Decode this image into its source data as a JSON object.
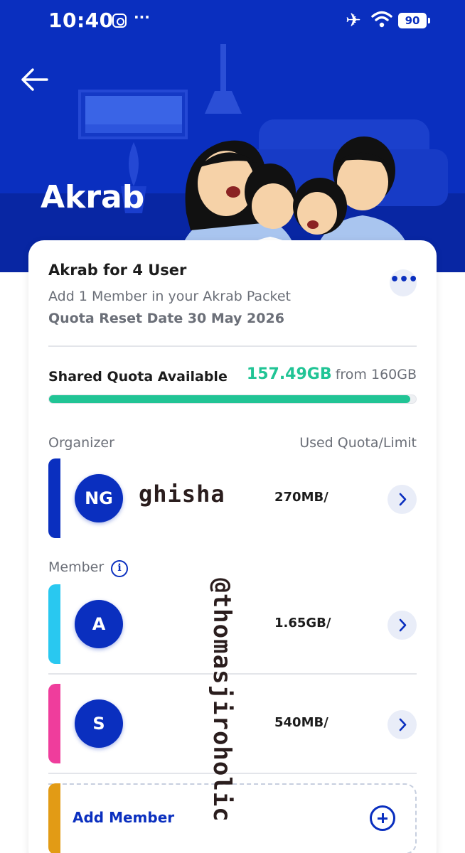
{
  "status_bar": {
    "time": "10:40",
    "dots": "···",
    "battery": "90",
    "icons": [
      "instagram-icon",
      "more-dots-icon",
      "airplane-icon",
      "wifi-icon",
      "battery-icon"
    ]
  },
  "header": {
    "title": "Akrab",
    "back_icon": "arrow-left-icon"
  },
  "package": {
    "title": "Akrab for 4 User",
    "subtitle": "Add 1 Member in your Akrab Packet",
    "reset": "Quota Reset Date 30 May 2026",
    "more_icon": "more-horizontal-icon",
    "more_glyph": "•••"
  },
  "quota": {
    "label": "Shared Quota Available",
    "available": "157.49GB",
    "total": "from 160GB",
    "fraction": 0.9843
  },
  "organizer": {
    "section_label": "Organizer",
    "column_label": "Used Quota/Limit",
    "initials": "NG",
    "usage": "270MB/",
    "bar_color": "#0a2fbf"
  },
  "members": {
    "section_label": "Member",
    "info_glyph": "i",
    "list": [
      {
        "initials": "A",
        "usage": "1.65GB/",
        "bar_color": "#29c8f0"
      },
      {
        "initials": "S",
        "usage": "540MB/",
        "bar_color": "#ef3d9c"
      }
    ]
  },
  "add_member": {
    "label": "Add Member",
    "icon": "plus-circle-icon"
  },
  "watermarks": {
    "name": "ghisha",
    "handle": "@thomasjiroholic"
  },
  "colors": {
    "brand": "#0a2fbf",
    "accent_green": "#21c495",
    "muted_text": "#6b6f78"
  }
}
